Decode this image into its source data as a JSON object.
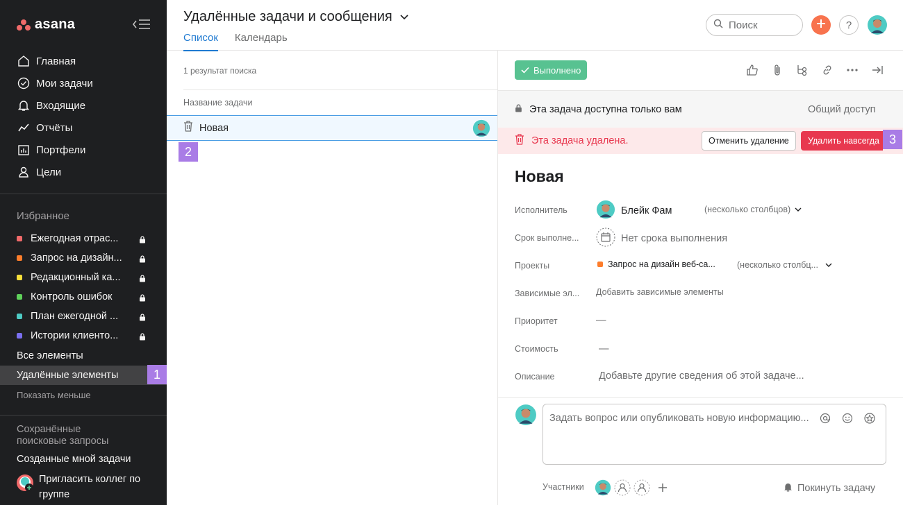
{
  "app": {
    "logo_text": "asana"
  },
  "sidebar": {
    "nav": [
      {
        "label": "Главная",
        "icon": "home-icon"
      },
      {
        "label": "Мои задачи",
        "icon": "check-circle-icon"
      },
      {
        "label": "Входящие",
        "icon": "bell-icon"
      },
      {
        "label": "Отчёты",
        "icon": "chart-line-icon"
      },
      {
        "label": "Портфели",
        "icon": "portfolio-icon"
      },
      {
        "label": "Цели",
        "icon": "person-icon"
      }
    ],
    "favorites_title": "Избранное",
    "favorites": [
      {
        "label": "Ежегодная отрас...",
        "color": "#f06a6a"
      },
      {
        "label": "Запрос на дизайн...",
        "color": "#fd7d2b"
      },
      {
        "label": "Редакционный ка...",
        "color": "#f8df3a"
      },
      {
        "label": "Контроль ошибок",
        "color": "#5fd15a"
      },
      {
        "label": "План ежегодной ...",
        "color": "#4ecbc4"
      },
      {
        "label": "Истории клиенто...",
        "color": "#7a6ff0"
      }
    ],
    "all_items": "Все элементы",
    "deleted_items": "Удалённые элементы",
    "show_less": "Показать меньше",
    "saved_title": "Сохранённые поисковые запросы",
    "created_tasks": "Созданные мной задачи",
    "invite": "Пригласить коллег по группе"
  },
  "badges": {
    "one": "1",
    "two": "2",
    "three": "3"
  },
  "header": {
    "title": "Удалённые задачи и сообщения",
    "tabs": [
      "Список",
      "Календарь"
    ],
    "search_placeholder": "Поиск",
    "help": "?"
  },
  "list": {
    "result_count": "1 результат поиска",
    "column_header": "Название задачи",
    "rows": [
      {
        "name": "Новая"
      }
    ]
  },
  "detail": {
    "done_label": "Выполнено",
    "private_notice": "Эта задача доступна только вам",
    "share": "Общий доступ",
    "deleted_notice": "Эта задача удалена.",
    "restore": "Отменить удаление",
    "delete_forever": "Удалить навсегда",
    "title": "Новая",
    "fields": {
      "assignee_label": "Исполнитель",
      "assignee_value": "Блейк Фам",
      "assignee_extra": "(несколько столбцов)",
      "due_label": "Срок выполне...",
      "due_value": "Нет срока выполнения",
      "projects_label": "Проекты",
      "project_value": "Запрос на дизайн веб-са...",
      "project_extra": "(несколько столбц...",
      "project_color": "#fd7d2b",
      "dependencies_label": "Зависимые эл...",
      "dependencies_value": "Добавить зависимые элементы",
      "priority_label": "Приоритет",
      "priority_value": "—",
      "cost_label": "Стоимость",
      "cost_value": "—",
      "description_label": "Описание",
      "description_value": "Добавьте другие сведения об этой задаче..."
    },
    "composer_placeholder": "Задать вопрос или опубликовать новую информацию...",
    "participants_label": "Участники",
    "leave_task": "Покинуть задачу"
  },
  "colors": {
    "accent": "#1f7ad1",
    "success": "#58c291",
    "danger": "#e8384f",
    "badge": "#a97ce6"
  }
}
